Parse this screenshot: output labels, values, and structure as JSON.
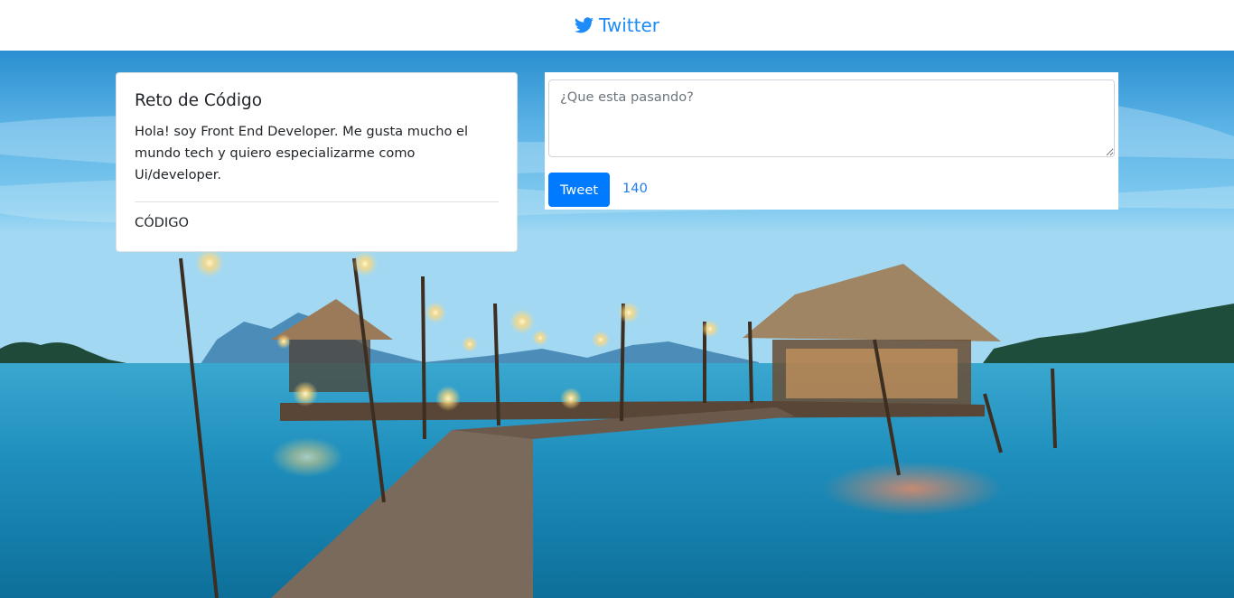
{
  "navbar": {
    "brand_icon": "twitter-bird-icon",
    "brand_label": "Twitter",
    "brand_color": "#1d8cf8"
  },
  "profile": {
    "title": "Reto de Código",
    "description": "Hola! soy Front End Developer. Me gusta mucho el mundo tech y quiero especializarme como Ui/developer.",
    "footer_label": "CÓDIGO"
  },
  "compose": {
    "placeholder": "¿Que esta pasando?",
    "value": "",
    "tweet_label": "Tweet",
    "char_count": "140",
    "button_color": "#007bff"
  },
  "background": {
    "subject": "tropical-pier-photo"
  }
}
